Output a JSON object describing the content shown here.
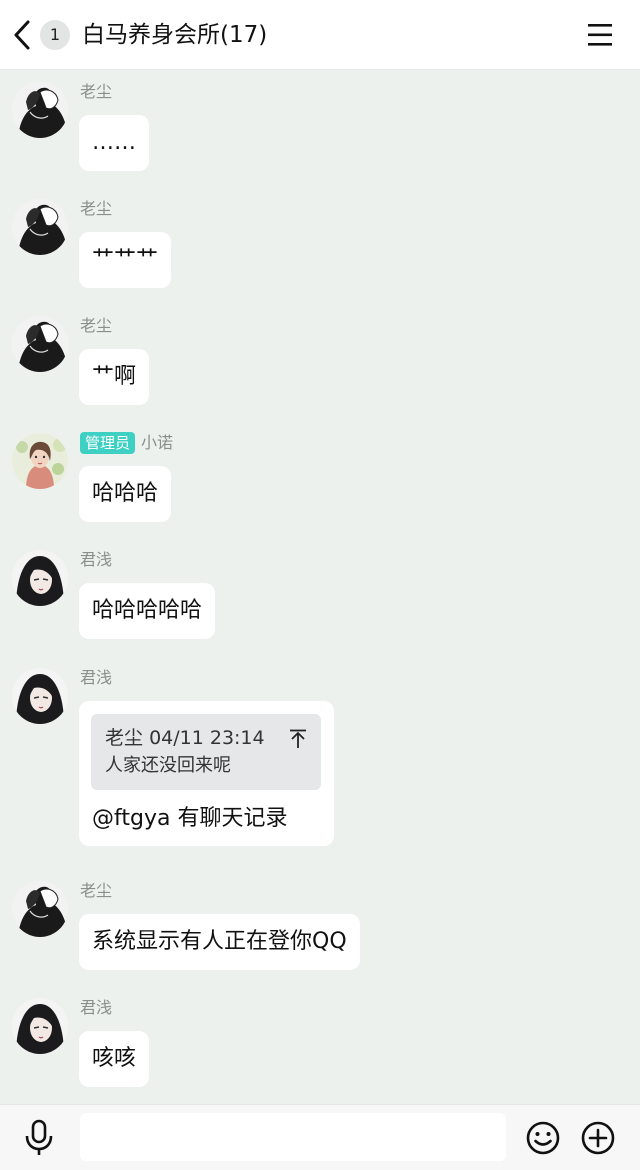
{
  "header": {
    "unread_count": "1",
    "title": "白马养身会所(17)"
  },
  "messages": [
    {
      "sender": "老尘",
      "admin_tag": "",
      "avatar": "avatar-laochen",
      "text": "……"
    },
    {
      "sender": "老尘",
      "admin_tag": "",
      "avatar": "avatar-laochen",
      "text": "艹艹艹"
    },
    {
      "sender": "老尘",
      "admin_tag": "",
      "avatar": "avatar-laochen",
      "text": "艹啊"
    },
    {
      "sender": "小诺",
      "admin_tag": "管理员",
      "avatar": "avatar-xiaonuo",
      "text": "哈哈哈"
    },
    {
      "sender": "君浅",
      "admin_tag": "",
      "avatar": "avatar-junqian",
      "text": "哈哈哈哈哈"
    },
    {
      "sender": "君浅",
      "admin_tag": "",
      "avatar": "avatar-junqian",
      "text": "@ftgya 有聊天记录",
      "quote": {
        "author": "老尘",
        "time": "04/11 23:14",
        "text": "人家还没回来呢"
      }
    },
    {
      "sender": "老尘",
      "admin_tag": "",
      "avatar": "avatar-laochen",
      "text": "系统显示有人正在登你QQ"
    },
    {
      "sender": "君浅",
      "admin_tag": "",
      "avatar": "avatar-junqian",
      "text": "咳咳"
    }
  ],
  "input": {
    "value": "",
    "placeholder": ""
  },
  "colors": {
    "chat_background": "#edf1ee",
    "admin_tag": "#3fd0c4",
    "bubble": "#ffffff"
  },
  "icons": {
    "back": "chevron-left-icon",
    "menu": "hamburger-menu-icon",
    "voice": "microphone-icon",
    "emoji": "smiley-icon",
    "more": "plus-circle-icon",
    "quote_jump": "jump-to-top-icon"
  }
}
